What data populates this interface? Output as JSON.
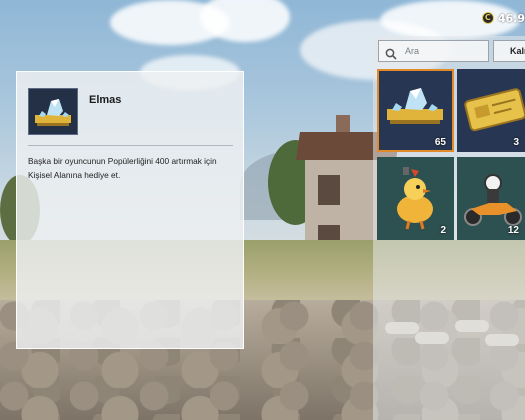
{
  "header": {
    "currency_value": "46.9",
    "currency_icon": "coin-icon"
  },
  "item_detail": {
    "name": "Elmas",
    "description": "Başka bir oyuncunun Popülerliğini 400 artırmak için Kişisel Alanına hediye et.",
    "icon": "diamond-icon"
  },
  "inventory": {
    "search_placeholder": "Ara",
    "filter_label": "Kalı",
    "items": [
      {
        "icon": "diamond-icon",
        "count": "65",
        "background": "#273653",
        "selected": true
      },
      {
        "icon": "gold-card-icon",
        "count": "3",
        "background": "#273653",
        "selected": false
      },
      {
        "icon": "chicken-emote-icon",
        "count": "2",
        "background": "#2d5050",
        "selected": false
      },
      {
        "icon": "motorbike-rider-icon",
        "count": "12",
        "background": "#2d5050",
        "selected": false
      }
    ]
  },
  "colors": {
    "selection_border": "#e08a2a",
    "tile_blue": "#273653",
    "tile_teal": "#2d5050"
  }
}
